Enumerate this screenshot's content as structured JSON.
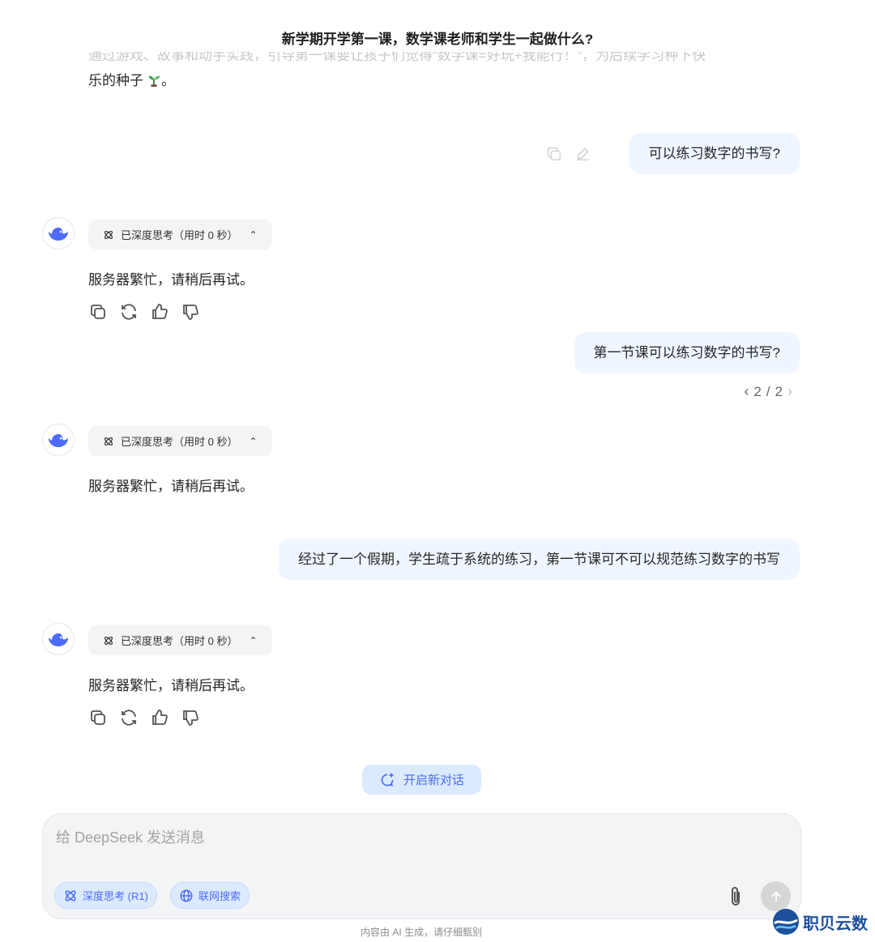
{
  "header": {
    "title": "新学期开学第一课，数学课老师和学生一起做什么?"
  },
  "previous_reply": {
    "faded_line": "通过游戏、故事和动手实践，引导第一课要让孩子们觉得“数学课=好玩+我能行！”，为后续学习种下快",
    "tail_text": "乐的种子"
  },
  "conversation": {
    "user_1": "可以练习数字的书写?",
    "user_2": "第一节课可以练习数字的书写?",
    "user_2_pager": {
      "current": "2",
      "separator": "/",
      "total": "2"
    },
    "user_3": "经过了一个假期，学生疏于系统的练习，第一节课可不可以规范练习数字的书写",
    "think_label": "已深度思考（用时 0 秒）",
    "ai_1": "服务器繁忙，请稍后再试。",
    "ai_2": "服务器繁忙，请稍后再试。",
    "ai_3": "服务器繁忙，请稍后再试。"
  },
  "new_chat": {
    "label": "开启新对话"
  },
  "composer": {
    "placeholder": "给 DeepSeek 发送消息",
    "deep_think_label": "深度思考 (R1)",
    "web_search_label": "联网搜索"
  },
  "footer": {
    "note": "内容由 AI 生成，请仔细甄别"
  },
  "watermark": {
    "text": "职贝云数"
  },
  "colors": {
    "accent": "#4d6bfe",
    "bubble": "#eff6ff",
    "chip": "#f3f4f6"
  },
  "icons": [
    "copy-icon",
    "edit-icon",
    "refresh-icon",
    "thumbs-up-icon",
    "thumbs-down-icon",
    "atom-icon",
    "globe-icon",
    "paperclip-icon",
    "arrow-up-icon",
    "new-chat-icon",
    "deepseek-whale-icon"
  ]
}
